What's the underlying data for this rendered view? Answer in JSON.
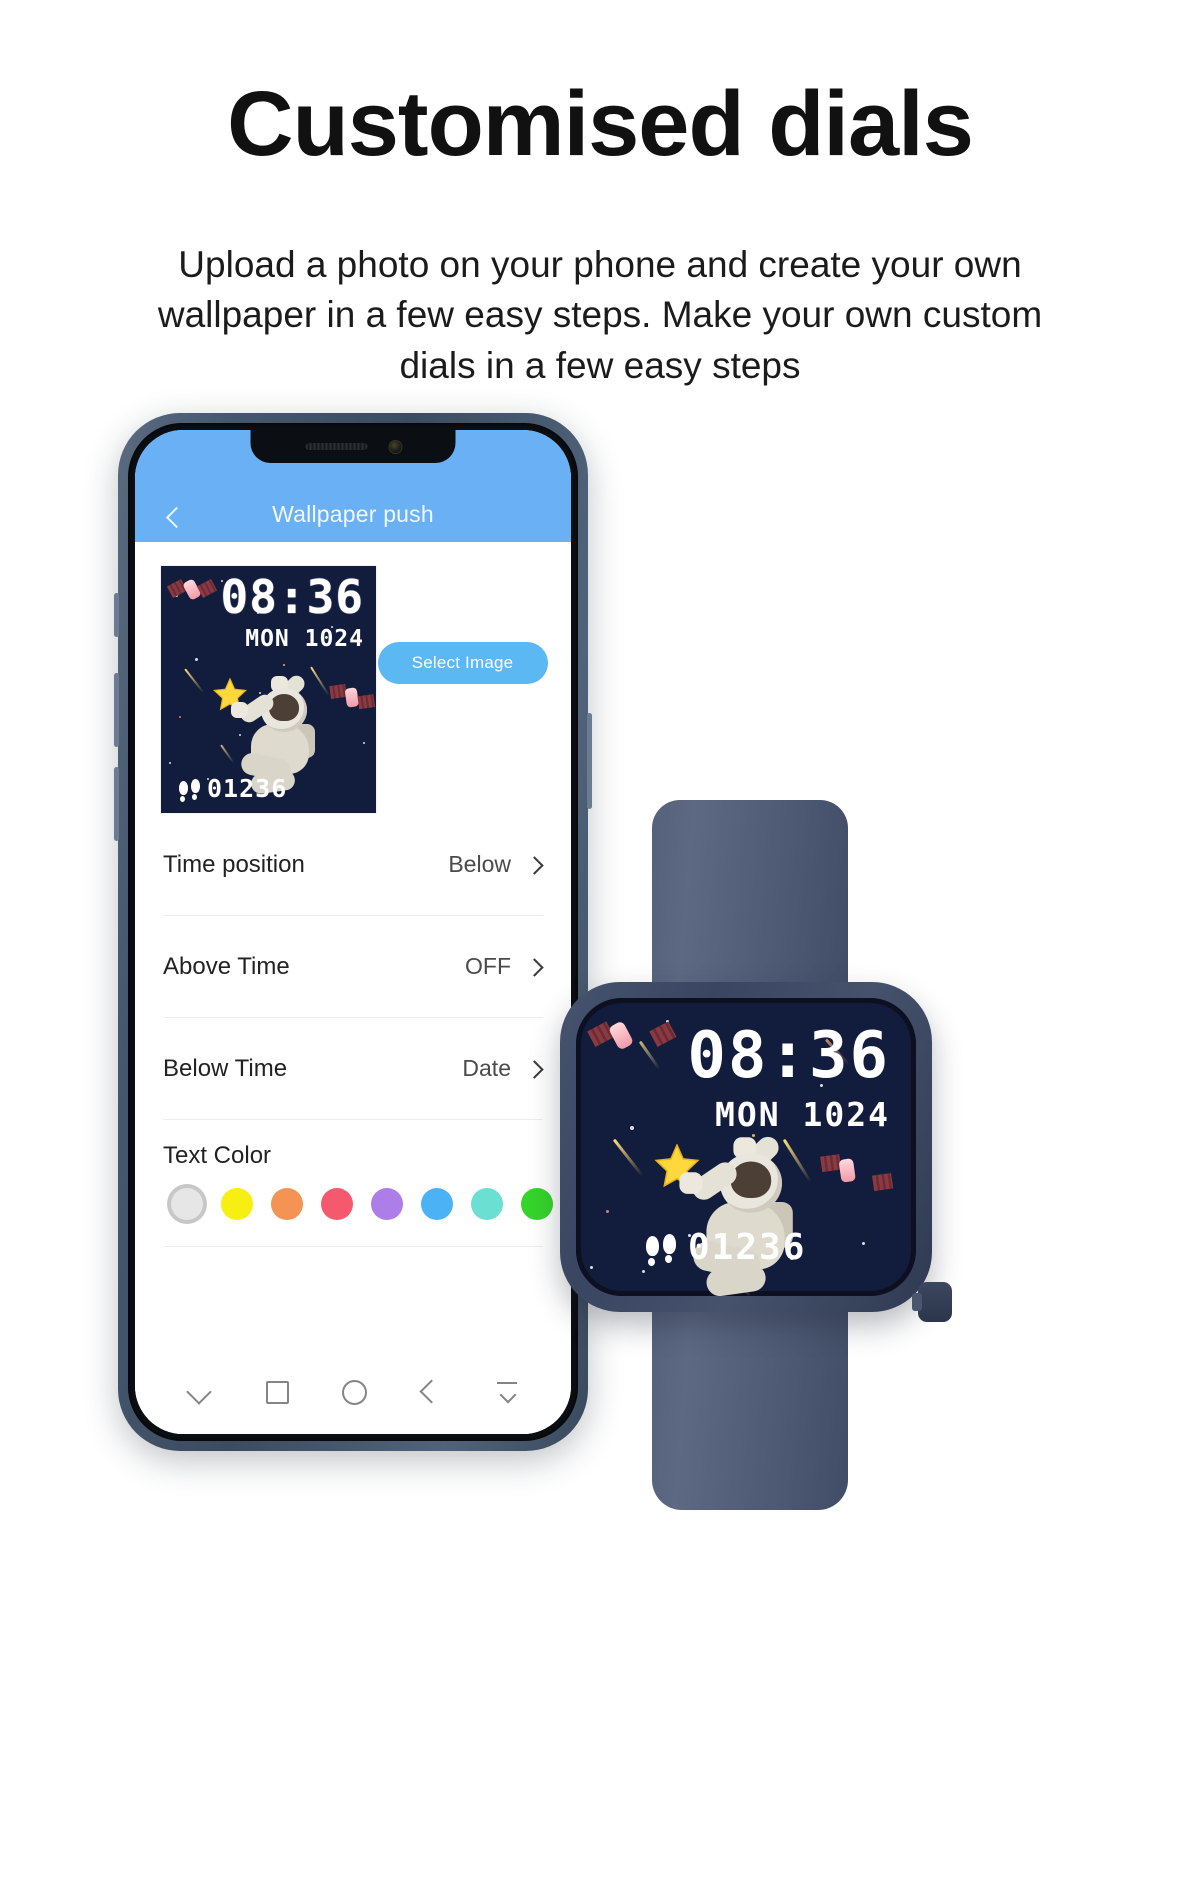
{
  "hero": {
    "title": "Customised dials",
    "description": "Upload a photo on your phone and create your own wallpaper in a few easy steps. Make your own custom dials in a few easy steps"
  },
  "phone": {
    "appbar": {
      "back_icon": "chevron-left-icon",
      "title": "Wallpaper push"
    },
    "preview": {
      "dial_time": "08:36",
      "dial_date": "MON 1024",
      "dial_steps": "01236",
      "select_image_label": "Select Image"
    },
    "settings": [
      {
        "label": "Time position",
        "value": "Below"
      },
      {
        "label": "Above Time",
        "value": "OFF"
      },
      {
        "label": "Below Time",
        "value": "Date"
      }
    ],
    "text_color": {
      "label": "Text Color",
      "swatches": [
        {
          "name": "white",
          "hex": "#e6e6e6",
          "selected": true
        },
        {
          "name": "black",
          "hex": "#000000",
          "selected": false
        },
        {
          "name": "yellow",
          "hex": "#f7ef12",
          "selected": false
        },
        {
          "name": "orange",
          "hex": "#f59355",
          "selected": false
        },
        {
          "name": "pink-red",
          "hex": "#f4596e",
          "selected": false
        },
        {
          "name": "purple",
          "hex": "#ad7ee8",
          "selected": false
        },
        {
          "name": "blue",
          "hex": "#4bb2f5",
          "selected": false
        },
        {
          "name": "cyan",
          "hex": "#6bdfd2",
          "selected": false
        },
        {
          "name": "green",
          "hex": "#35d42a",
          "selected": false
        }
      ]
    },
    "navbar": [
      {
        "name": "chevron-down-icon"
      },
      {
        "name": "square-icon"
      },
      {
        "name": "circle-icon"
      },
      {
        "name": "back-triangle-icon"
      },
      {
        "name": "collapse-icon"
      }
    ]
  },
  "watch": {
    "time": "08:36",
    "date": "MON 1024",
    "steps": "01236",
    "body_color": "#44506a",
    "screen_color": "#121c3d"
  }
}
